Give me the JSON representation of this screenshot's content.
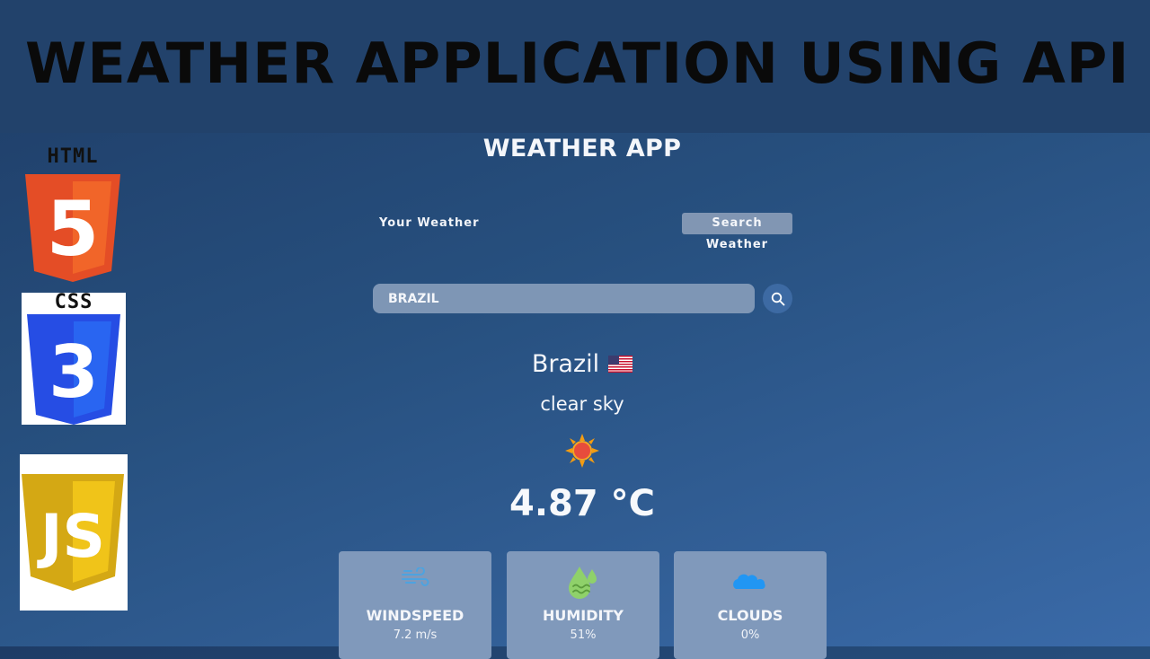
{
  "banner": {
    "title": "WEATHER APPLICATION USING API"
  },
  "logos": {
    "html": {
      "label": "HTML",
      "glyph": "5",
      "color": "#e44d26"
    },
    "css": {
      "label": "CSS",
      "glyph": "3",
      "color": "#264de4"
    },
    "js": {
      "glyph": "JS",
      "color": "#d4a814"
    }
  },
  "app": {
    "title": "WEATHER APP",
    "tabs": {
      "your_weather": "Your Weather",
      "search_weather": "Search Weather"
    },
    "search": {
      "value": "BRAZIL",
      "icon": "search-icon"
    },
    "city": "Brazil",
    "flag_icon": "us-flag-icon",
    "description": "clear sky",
    "weather_icon": "sun-icon",
    "temperature": "4.87 °C",
    "cards": [
      {
        "label": "WINDSPEED",
        "value": "7.2 m/s",
        "icon": "wind-icon"
      },
      {
        "label": "HUMIDITY",
        "value": "51%",
        "icon": "humidity-icon"
      },
      {
        "label": "CLOUDS",
        "value": "0%",
        "icon": "cloud-icon"
      }
    ]
  },
  "colors": {
    "background": "#27507f",
    "card": "#8099bb",
    "accent": "#3d6aa3"
  }
}
